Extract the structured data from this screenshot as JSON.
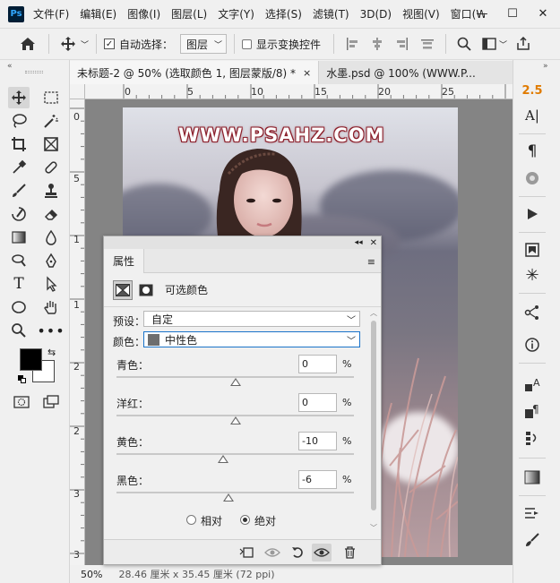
{
  "app": {
    "logo": "Ps"
  },
  "menu": [
    "文件(F)",
    "编辑(E)",
    "图像(I)",
    "图层(L)",
    "文字(Y)",
    "选择(S)",
    "滤镜(T)",
    "3D(D)",
    "视图(V)",
    "窗口(W"
  ],
  "window_controls": {
    "minimize": "—",
    "maximize": "☐",
    "close": "✕"
  },
  "options_bar": {
    "auto_select_label": "自动选择：",
    "auto_select_checked": true,
    "auto_select_target": "图层",
    "show_transform_label": "显示变换控件",
    "show_transform_checked": false
  },
  "tabs": [
    {
      "label": "未标题-2 @ 50% (选取颜色 1, 图层蒙版/8) *",
      "close": "×"
    },
    {
      "label": "水墨.psd @ 100% (WWW.P...",
      "close": ""
    }
  ],
  "ruler_h": [
    "0",
    "5",
    "10",
    "15",
    "20",
    "25"
  ],
  "ruler_v": [
    "0",
    "5",
    "1",
    "1",
    "2",
    "2",
    "3",
    "3"
  ],
  "canvas": {
    "watermark": "WWW.PSAHZ.COM"
  },
  "status": {
    "zoom": "50%",
    "info": "28.46 厘米 x 35.45 厘米 (72 ppi)"
  },
  "right_panel": {
    "char_size": "2.5"
  },
  "properties": {
    "tab_label": "属性",
    "adjustment_title": "可选颜色",
    "preset_label": "预设：",
    "preset_value": "自定",
    "colors_label": "颜色：",
    "colors_value": "中性色",
    "colors_swatch": "#6e6e6e",
    "sliders": [
      {
        "label": "青色：",
        "value": "0",
        "unit": "%",
        "level": 0
      },
      {
        "label": "洋红：",
        "value": "0",
        "unit": "%",
        "level": 0
      },
      {
        "label": "黄色：",
        "value": "-10",
        "unit": "%",
        "level": -10
      },
      {
        "label": "黑色：",
        "value": "-6",
        "unit": "%",
        "level": -6
      }
    ],
    "method_relative": "相对",
    "method_absolute": "绝对",
    "method_selected": "绝对"
  },
  "colors": {
    "accent": "#e07b00",
    "select_focus": "#1a73c9",
    "foreground": "#000000",
    "background": "#ffffff"
  }
}
